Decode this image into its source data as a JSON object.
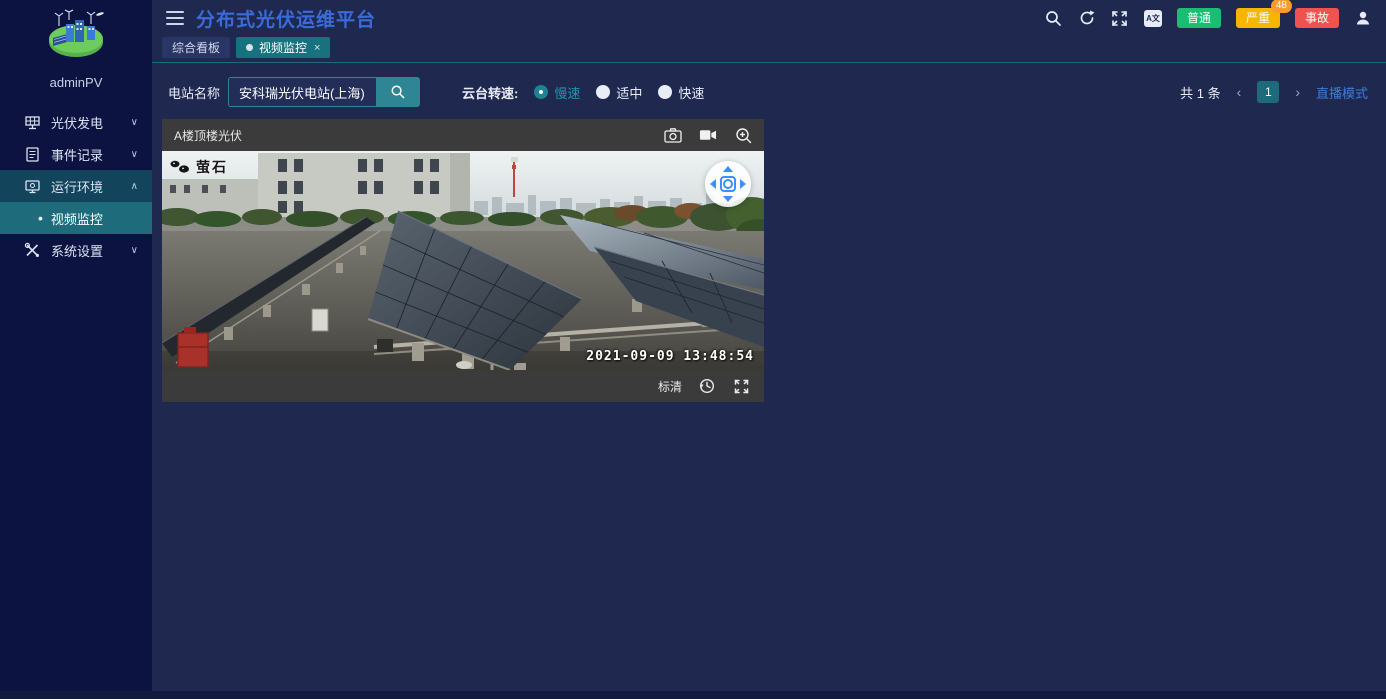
{
  "header": {
    "title": "分布式光伏运维平台",
    "translate_label": "A文",
    "badges": [
      {
        "label": "普通",
        "color": "#1abd71",
        "count": ""
      },
      {
        "label": "严重",
        "color": "#f7b500",
        "count": "48"
      },
      {
        "label": "事故",
        "color": "#ef5350",
        "count": ""
      }
    ]
  },
  "sidebar": {
    "username": "adminPV",
    "menu": [
      {
        "label": "光伏发电",
        "expanded": false
      },
      {
        "label": "事件记录",
        "expanded": false
      },
      {
        "label": "运行环境",
        "expanded": true,
        "children": [
          {
            "label": "视频监控",
            "active": true
          }
        ]
      },
      {
        "label": "系统设置",
        "expanded": false
      }
    ],
    "bullet": "•",
    "chevron_down": "∨",
    "chevron_up": "∧"
  },
  "tabs": [
    {
      "label": "综合看板",
      "active": false
    },
    {
      "label": "视频监控",
      "active": true,
      "close": "×"
    }
  ],
  "toolbar": {
    "station_label": "电站名称",
    "station_value": "安科瑞光伏电站(上海)",
    "speed_label": "云台转速:",
    "speed_options": [
      {
        "label": "慢速",
        "selected": true
      },
      {
        "label": "适中",
        "selected": false
      },
      {
        "label": "快速",
        "selected": false
      }
    ],
    "total_text": "共 1 条",
    "prev": "‹",
    "next": "›",
    "page": "1",
    "live_mode": "直播模式"
  },
  "video": {
    "title": "A楼顶楼光伏",
    "watermark": "萤石",
    "timestamp": "2021-09-09 13:48:54",
    "quality": "标清"
  },
  "icons": {
    "search": "magnifier",
    "refresh": "circular-arrows",
    "fullscreen": "expand-arrows",
    "translate": "A-wen-box",
    "user": "person-silhouette",
    "snapshot": "photo-camera",
    "record": "video-camera",
    "zoom_in": "magnifier-plus",
    "replay": "circular-arrow-clock",
    "expand": "corner-arrows",
    "hamburger": "three-lines"
  },
  "colors": {
    "sidebar_bg": "#0c1340",
    "main_bg": "#1f2950",
    "accent_teal": "#1d6a7a",
    "active_tab": "#17717f",
    "title_blue": "#3b6bd8",
    "link_blue": "#3d7bdb",
    "badge_normal": "#1abd71",
    "badge_severe": "#f7b500",
    "badge_accident": "#ef5350",
    "count_bubble": "#ff9a2e",
    "panel_gray": "#3b3b3b",
    "ptz_arrow": "#3e8ef7"
  }
}
